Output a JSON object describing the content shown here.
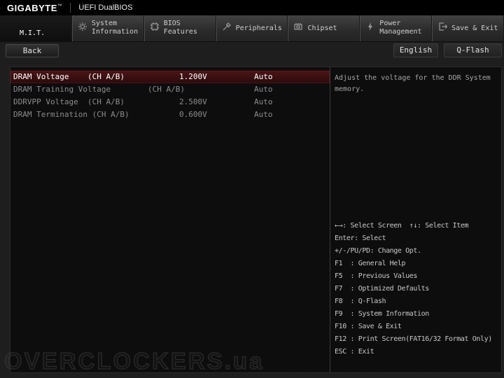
{
  "header": {
    "brand": "GIGABYTE",
    "trademark": "™",
    "subtitle": "UEFI DualBIOS"
  },
  "tabs": [
    {
      "line1": "M.I.T.",
      "line2": "",
      "active": true
    },
    {
      "line1": "System",
      "line2": "Information",
      "active": false
    },
    {
      "line1": "BIOS",
      "line2": "Features",
      "active": false
    },
    {
      "line1": "Peripherals",
      "line2": "",
      "active": false
    },
    {
      "line1": "Chipset",
      "line2": "",
      "active": false
    },
    {
      "line1": "Power",
      "line2": "Management",
      "active": false
    },
    {
      "line1": "Save & Exit",
      "line2": "",
      "active": false
    }
  ],
  "toolbar": {
    "back": "Back",
    "language": "English",
    "qflash": "Q-Flash"
  },
  "settings": {
    "rows": [
      {
        "label": "DRAM Voltage    (CH A/B)",
        "value": "1.200V",
        "option": "Auto",
        "selected": true
      },
      {
        "label": "DRAM Training Voltage        (CH A/B)",
        "value": "",
        "option": "Auto",
        "selected": false
      },
      {
        "label": "DDRVPP Voltage  (CH A/B)",
        "value": "2.500V",
        "option": "Auto",
        "selected": false
      },
      {
        "label": "DRAM Termination (CH A/B)",
        "value": "0.600V",
        "option": "Auto",
        "selected": false
      }
    ]
  },
  "help": {
    "description": "Adjust the voltage for the DDR System memory.",
    "keys": [
      "←→: Select Screen  ↑↓: Select Item",
      "Enter: Select",
      "+/-/PU/PD: Change Opt.",
      "F1  : General Help",
      "F5  : Previous Values",
      "F7  : Optimized Defaults",
      "F8  : Q-Flash",
      "F9  : System Information",
      "F10 : Save & Exit",
      "F12 : Print Screen(FAT16/32 Format Only)",
      "ESC : Exit"
    ]
  },
  "watermark": "OVERCLOCKERS.ua",
  "colors": {
    "highlight_row": "#4d1416",
    "accent_red": "#c21f1f"
  }
}
